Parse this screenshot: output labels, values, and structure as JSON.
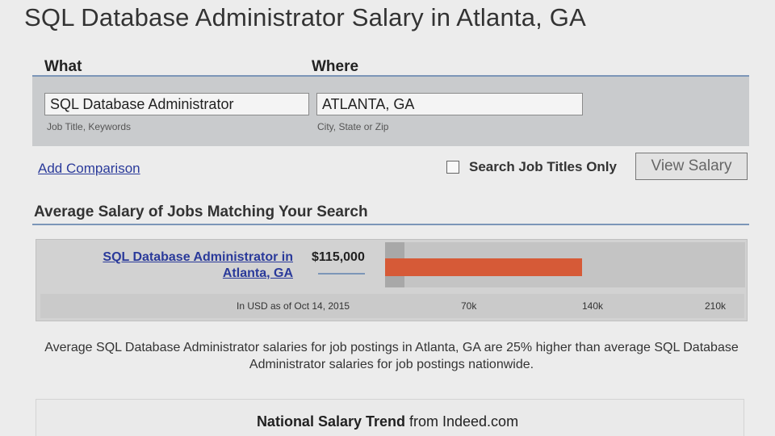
{
  "page": {
    "title": "SQL Database Administrator Salary in Atlanta, GA"
  },
  "search": {
    "what_label": "What",
    "where_label": "Where",
    "what_value": "SQL Database Administrator",
    "where_value": "ATLANTA, GA",
    "what_hint": "Job Title, Keywords",
    "where_hint": "City, State or Zip",
    "add_comparison": "Add Comparison",
    "titles_only_label": "Search Job Titles Only",
    "titles_only_checked": false,
    "submit_label": "View Salary"
  },
  "results": {
    "section_title": "Average Salary of Jobs Matching Your Search",
    "job_line1": "SQL Database Administrator in",
    "job_line2": "Atlanta, GA",
    "salary_text": "$115,000",
    "salary_value": 115000,
    "axis_max": 210000,
    "axis_note": "In USD as of Oct 14, 2015",
    "ticks": [
      "70k",
      "140k",
      "210k"
    ],
    "bar_color": "#d65a37"
  },
  "description": "Average SQL Database Administrator salaries for job postings in Atlanta, GA are 25% higher than average SQL Database Administrator salaries for job postings nationwide.",
  "trend": {
    "title_bold": "National Salary Trend",
    "title_rest": " from Indeed.com"
  }
}
